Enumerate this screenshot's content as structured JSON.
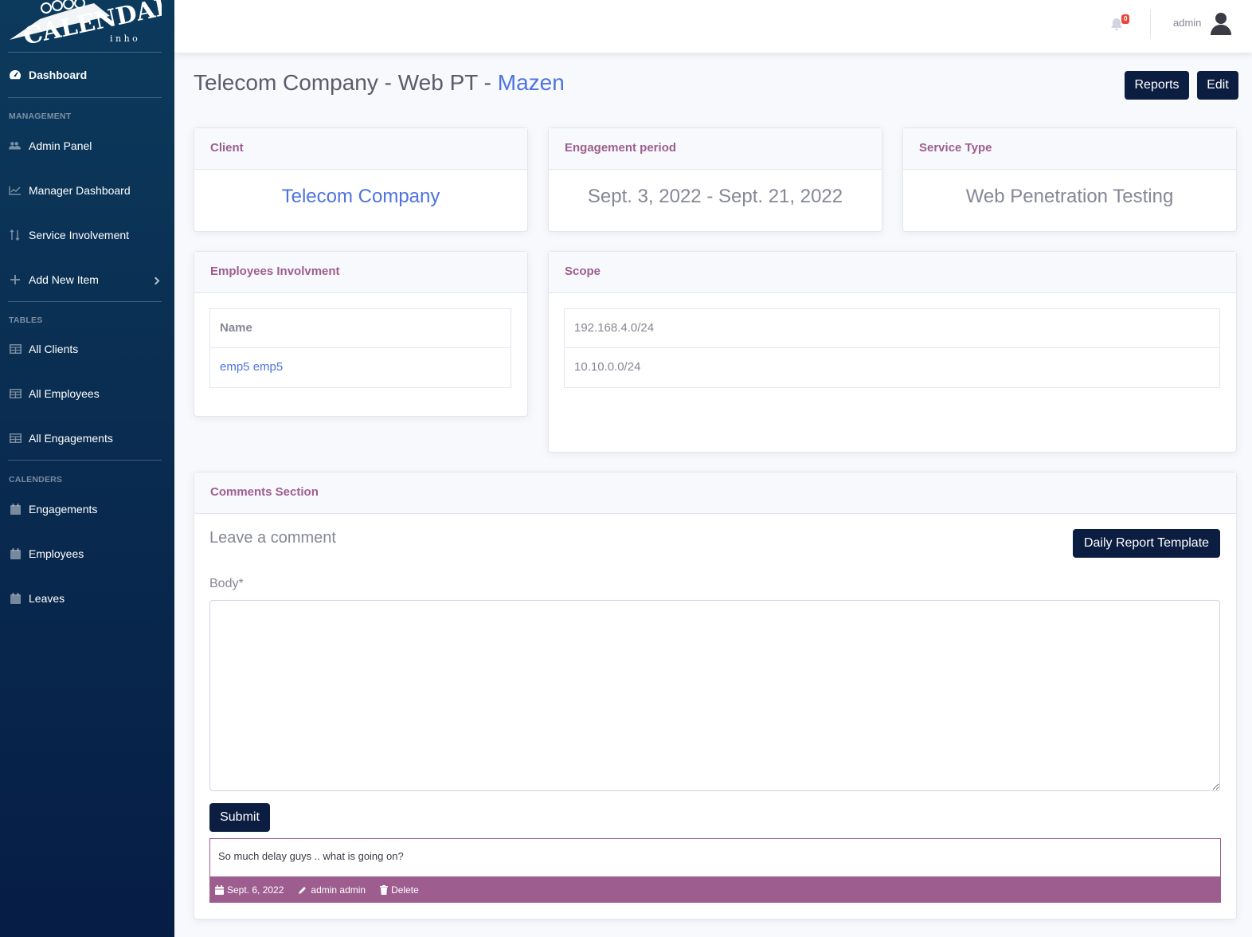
{
  "sidebar": {
    "logo_text": "CALENDAR",
    "logo_sub": "i n h o",
    "dashboard": "Dashboard",
    "sections": {
      "management": "MANAGEMENT",
      "tables": "TABLES",
      "calenders": "CALENDERS"
    },
    "items": {
      "admin_panel": "Admin Panel",
      "manager_dashboard": "Manager Dashboard",
      "service_involvement": "Service Involvement",
      "add_new_item": "Add New Item",
      "all_clients": "All Clients",
      "all_employees": "All Employees",
      "all_engagements": "All Engagements",
      "engagements": "Engagements",
      "employees": "Employees",
      "leaves": "Leaves"
    }
  },
  "topbar": {
    "notification_count": "0",
    "username": "admin"
  },
  "page": {
    "title_prefix": "Telecom Company - Web PT - ",
    "title_link": "Mazen",
    "reports_label": "Reports",
    "edit_label": "Edit"
  },
  "cards": {
    "client": {
      "header": "Client",
      "value": "Telecom Company"
    },
    "period": {
      "header": "Engagement period",
      "value": "Sept. 3, 2022 - Sept. 21, 2022"
    },
    "service": {
      "header": "Service Type",
      "value": "Web Penetration Testing"
    }
  },
  "employees": {
    "header": "Employees Involvment",
    "column": "Name",
    "rows": [
      "emp5 emp5"
    ]
  },
  "scope": {
    "header": "Scope",
    "rows": [
      "192.168.4.0/24",
      "10.10.0.0/24"
    ]
  },
  "comments": {
    "header": "Comments Section",
    "leave_label": "Leave a comment",
    "template_button": "Daily Report Template",
    "body_label": "Body*",
    "submit_label": "Submit",
    "entries": [
      {
        "text": "So much delay guys .. what is going on?",
        "date": "Sept. 6, 2022",
        "author": "admin admin",
        "delete_label": "Delete"
      }
    ]
  }
}
